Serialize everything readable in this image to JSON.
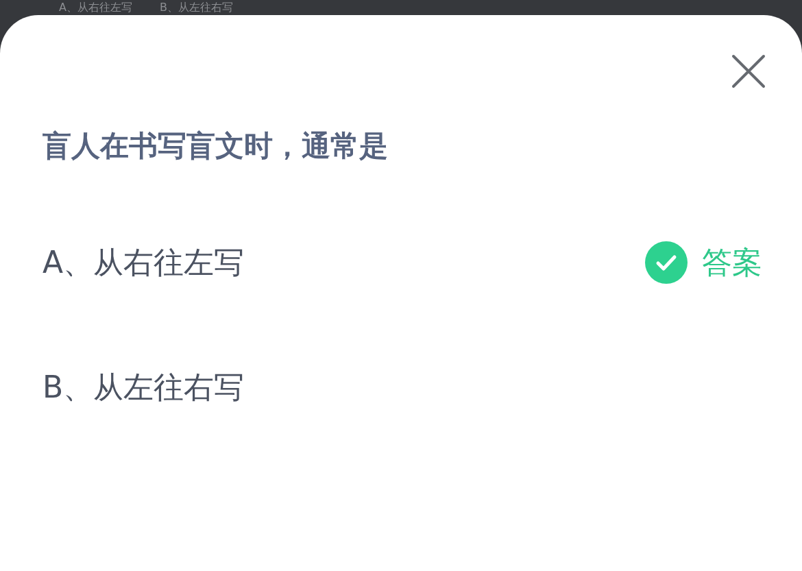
{
  "background_options": [
    "A、从右往左写",
    "B、从左往右写"
  ],
  "question": "盲人在书写盲文时，通常是",
  "options": [
    {
      "text": "A、从右往左写",
      "correct": true
    },
    {
      "text": "B、从左往右写",
      "correct": false
    }
  ],
  "answer_label": "答案"
}
